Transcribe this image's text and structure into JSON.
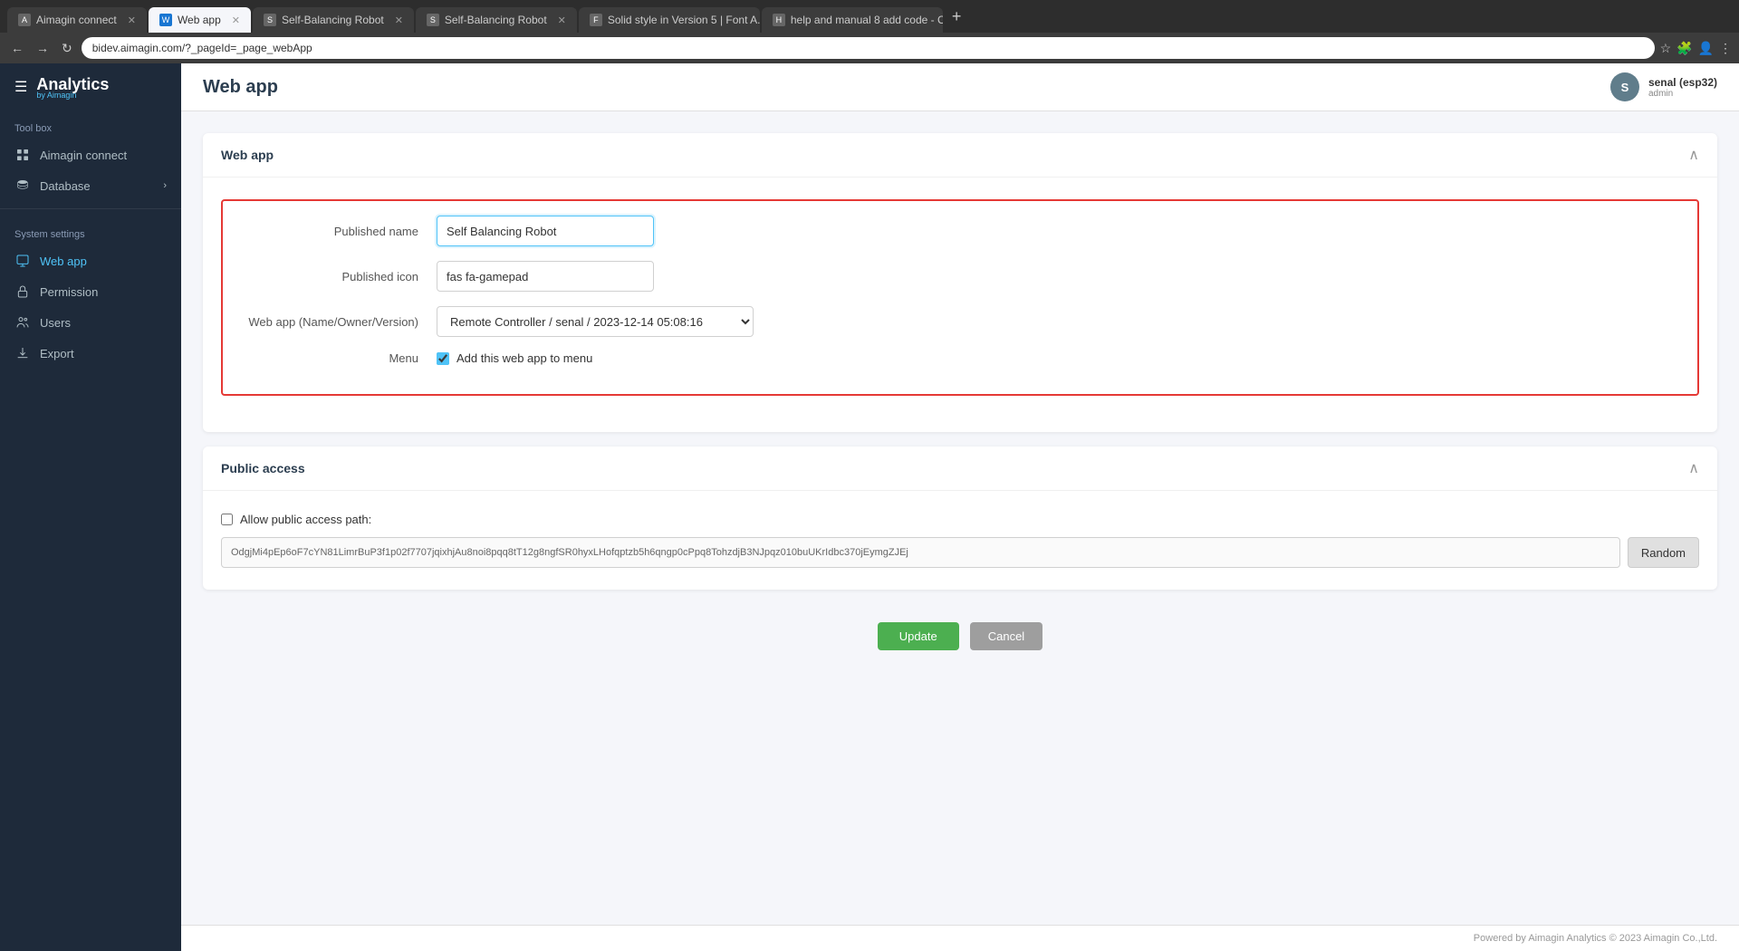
{
  "browser": {
    "address": "bidev.aimagin.com/?_pageId=_page_webApp",
    "tabs": [
      {
        "id": "tab1",
        "label": "Aimagin connect",
        "active": false,
        "favicon": "A"
      },
      {
        "id": "tab2",
        "label": "Web app",
        "active": true,
        "favicon": "W"
      },
      {
        "id": "tab3",
        "label": "Self-Balancing Robot",
        "active": false,
        "favicon": "S"
      },
      {
        "id": "tab4",
        "label": "Self-Balancing Robot",
        "active": false,
        "favicon": "S"
      },
      {
        "id": "tab5",
        "label": "Solid style in Version 5 | Font A...",
        "active": false,
        "favicon": "F"
      },
      {
        "id": "tab6",
        "label": "help and manual 8 add code - C...",
        "active": false,
        "favicon": "H"
      }
    ]
  },
  "sidebar": {
    "logo": "Analytics",
    "logo_sub": "by Aimagin",
    "toolbox_label": "Tool box",
    "items_toolbox": [
      {
        "label": "Aimagin connect",
        "icon": "🔌"
      },
      {
        "label": "Database",
        "icon": "🗄️",
        "has_chevron": true
      }
    ],
    "system_settings_label": "System settings",
    "items_system": [
      {
        "label": "Web app",
        "icon": "🌐",
        "active": true
      },
      {
        "label": "Permission",
        "icon": "🔒"
      },
      {
        "label": "Users",
        "icon": "👥"
      },
      {
        "label": "Export",
        "icon": "📤"
      }
    ]
  },
  "page": {
    "title": "Web app"
  },
  "webapp_section": {
    "title": "Web app",
    "fields": {
      "published_name_label": "Published name",
      "published_name_value": "Self Balancing Robot",
      "published_icon_label": "Published icon",
      "published_icon_value": "fas fa-gamepad",
      "webapp_name_label": "Web app (Name/Owner/Version)",
      "webapp_name_value": "Remote Controller / senal / 2023-12-14 05:08:16",
      "menu_label": "Menu",
      "menu_checkbox_label": "Add this web app to menu",
      "menu_checked": true
    }
  },
  "public_access_section": {
    "title": "Public access",
    "allow_checkbox_label": "Allow public access path:",
    "allow_checked": false,
    "path_value": "OdgjMi4pEp6oF7cYN81LimrBuP3f1p02f7707jqixhjAu8noi8pqq8tT12g8ngfSR0hyxLHofqptzb5h6qngp0cPpq8TohzdjB3NJpqz010buUKrIdbc370jEymgZJEj",
    "random_btn_label": "Random"
  },
  "actions": {
    "update_label": "Update",
    "cancel_label": "Cancel"
  },
  "footer": {
    "text": "Powered by Aimagin Analytics © 2023 Aimagin Co.,Ltd."
  },
  "user": {
    "name": "senal (esp32)",
    "role": "admin",
    "initials": "S"
  }
}
